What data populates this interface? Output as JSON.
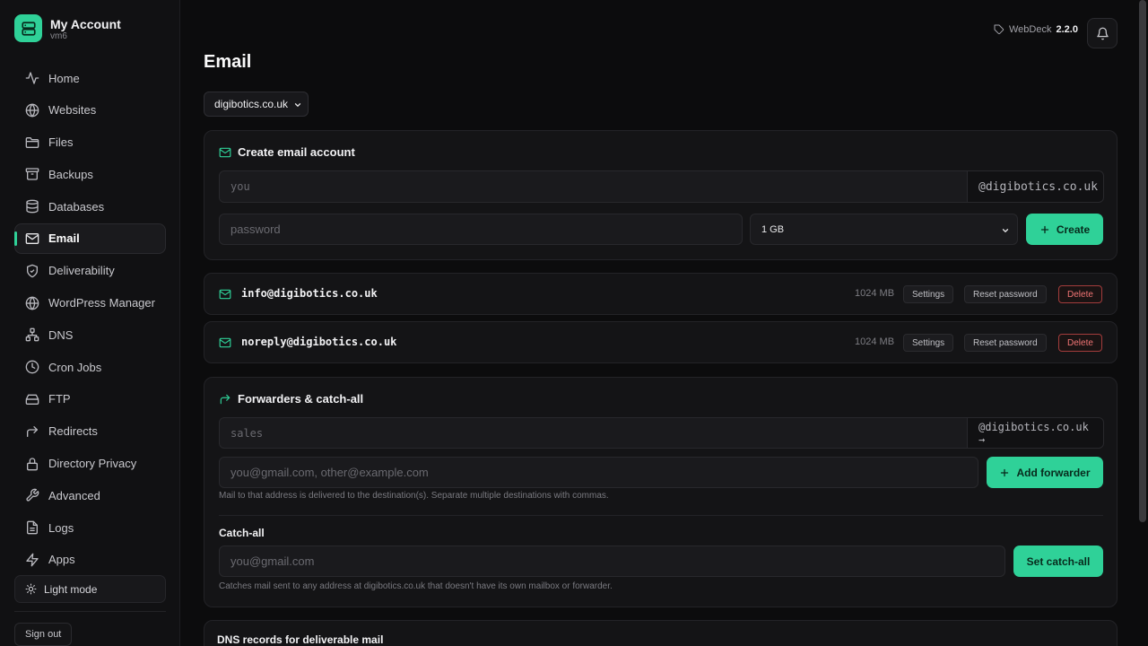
{
  "brand": {
    "title": "My Account",
    "subtitle": "vm6"
  },
  "nav": [
    {
      "label": "Home",
      "icon": "activity-icon"
    },
    {
      "label": "Websites",
      "icon": "globe-icon"
    },
    {
      "label": "Files",
      "icon": "folder-icon"
    },
    {
      "label": "Backups",
      "icon": "archive-icon"
    },
    {
      "label": "Databases",
      "icon": "database-icon"
    },
    {
      "label": "Email",
      "icon": "mail-icon",
      "active": true
    },
    {
      "label": "Deliverability",
      "icon": "shield-icon"
    },
    {
      "label": "WordPress Manager",
      "icon": "globe-icon"
    },
    {
      "label": "DNS",
      "icon": "network-icon"
    },
    {
      "label": "Cron Jobs",
      "icon": "clock-icon"
    },
    {
      "label": "FTP",
      "icon": "drive-icon"
    },
    {
      "label": "Redirects",
      "icon": "redirect-icon"
    },
    {
      "label": "Directory Privacy",
      "icon": "lock-icon"
    },
    {
      "label": "Advanced",
      "icon": "wrench-icon"
    },
    {
      "label": "Logs",
      "icon": "file-icon"
    },
    {
      "label": "Apps",
      "icon": "zap-icon"
    }
  ],
  "sidebar": {
    "theme_label": "Light mode",
    "signout_label": "Sign out"
  },
  "topbar": {
    "app_name": "WebDeck",
    "version": "2.2.0"
  },
  "page": {
    "title": "Email",
    "domain": "digibotics.co.uk"
  },
  "create": {
    "title": "Create email account",
    "user_placeholder": "you",
    "domain_suffix": "@digibotics.co.uk",
    "password_placeholder": "password",
    "quota": "1 GB",
    "button": "Create"
  },
  "mailboxes": [
    {
      "address": "info@digibotics.co.uk",
      "size": "1024 MB",
      "settings": "Settings",
      "reset": "Reset password",
      "delete": "Delete"
    },
    {
      "address": "noreply@digibotics.co.uk",
      "size": "1024 MB",
      "settings": "Settings",
      "reset": "Reset password",
      "delete": "Delete"
    }
  ],
  "forwarders": {
    "title": "Forwarders & catch-all",
    "source_placeholder": "sales",
    "domain_suffix": "@digibotics.co.uk →",
    "dest_placeholder": "you@gmail.com, other@example.com",
    "button": "Add forwarder",
    "hint": "Mail to that address is delivered to the destination(s). Separate multiple destinations with commas.",
    "catchall_title": "Catch-all",
    "catchall_placeholder": "you@gmail.com",
    "catchall_button": "Set catch-all",
    "catchall_hint": "Catches mail sent to any address at digibotics.co.uk that doesn't have its own mailbox or forwarder."
  },
  "dns": {
    "title": "DNS records for deliverable mail"
  },
  "colors": {
    "accent": "#2fd198",
    "danger": "#f07474",
    "background": "#0c0c0d"
  }
}
